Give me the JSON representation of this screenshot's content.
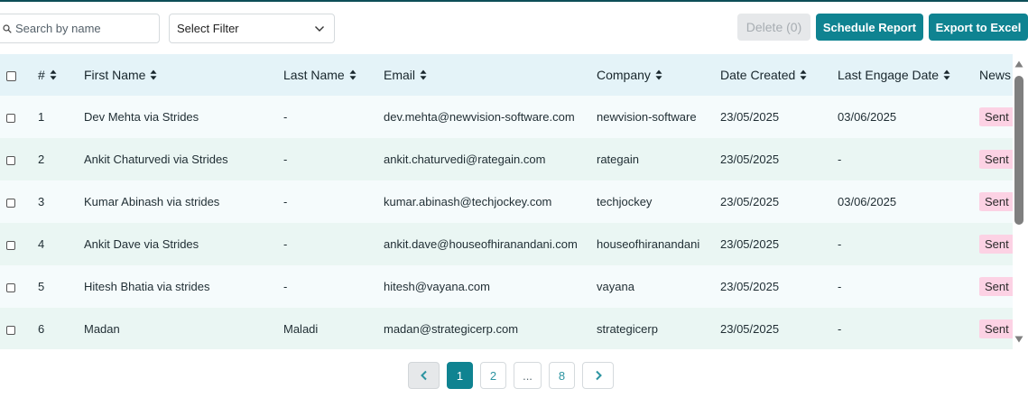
{
  "toolbar": {
    "search_placeholder": "Search by name",
    "filter_value": "Select Filter",
    "delete_label": "Delete (0)",
    "schedule_label": "Schedule Report",
    "export_label": "Export to Excel"
  },
  "table": {
    "columns": [
      "#",
      "First Name",
      "Last Name",
      "Email",
      "Company",
      "Date Created",
      "Last Engage Date",
      "News"
    ],
    "rows": [
      {
        "num": "1",
        "first_name": "Dev Mehta via Strides",
        "last_name": "-",
        "email": "dev.mehta@newvision-software.com",
        "company": "newvision-software",
        "date_created": "23/05/2025",
        "last_engage": "03/06/2025",
        "status": "Sent"
      },
      {
        "num": "2",
        "first_name": "Ankit Chaturvedi via Strides",
        "last_name": "-",
        "email": "ankit.chaturvedi@rategain.com",
        "company": "rategain",
        "date_created": "23/05/2025",
        "last_engage": "-",
        "status": "Sent"
      },
      {
        "num": "3",
        "first_name": "Kumar Abinash via strides",
        "last_name": "-",
        "email": "kumar.abinash@techjockey.com",
        "company": "techjockey",
        "date_created": "23/05/2025",
        "last_engage": "03/06/2025",
        "status": "Sent"
      },
      {
        "num": "4",
        "first_name": "Ankit Dave via Strides",
        "last_name": "-",
        "email": "ankit.dave@houseofhiranandani.com",
        "company": "houseofhiranandani",
        "date_created": "23/05/2025",
        "last_engage": "-",
        "status": "Sent"
      },
      {
        "num": "5",
        "first_name": "Hitesh Bhatia via strides",
        "last_name": "-",
        "email": "hitesh@vayana.com",
        "company": "vayana",
        "date_created": "23/05/2025",
        "last_engage": "-",
        "status": "Sent"
      },
      {
        "num": "6",
        "first_name": "Madan",
        "last_name": "Maladi",
        "email": "madan@strategicerp.com",
        "company": "strategicerp",
        "date_created": "23/05/2025",
        "last_engage": "-",
        "status": "Sent"
      }
    ]
  },
  "pagination": {
    "pages": [
      "1",
      "2",
      "...",
      "8"
    ],
    "current": "1"
  },
  "icons": {
    "search": "search-icon",
    "filter_caret": "chevron-down-icon",
    "sort": "sort-icon",
    "prev": "chevron-left-icon",
    "next": "chevron-right-icon"
  },
  "colors": {
    "accent": "#0f8391",
    "header_bg": "#e4f3f8",
    "badge_bg": "#fcd2e4"
  }
}
